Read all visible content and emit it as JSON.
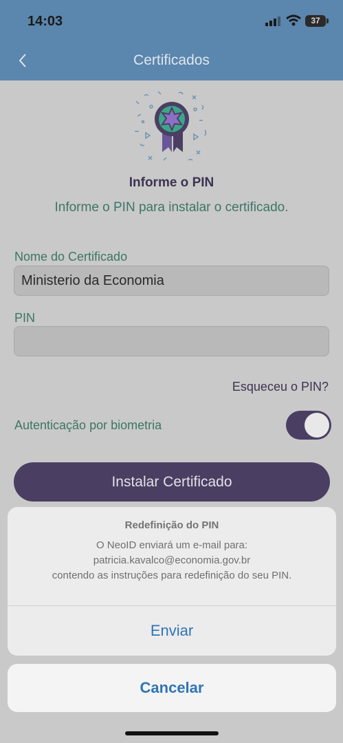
{
  "status": {
    "time": "14:03",
    "battery": "37"
  },
  "nav": {
    "title": "Certificados"
  },
  "icons": {
    "back": "chevron-left-icon",
    "illustration": "certificate-ribbon-icon"
  },
  "header": {
    "title": "Informe o PIN",
    "subtitle": "Informe o PIN para instalar o certificado."
  },
  "form": {
    "cert_label": "Nome do Certificado",
    "cert_value": "Ministerio da Economia",
    "pin_label": "PIN",
    "pin_value": "",
    "forgot_link": "Esqueceu o PIN?",
    "biometric_label": "Autenticação por biometria",
    "biometric_on": true,
    "install_button": "Instalar Certificado"
  },
  "action_sheet": {
    "title": "Redefinição do PIN",
    "line1": "O NeoID enviará um e-mail para:",
    "line2": "patricia.kavalco@economia.gov.br",
    "line3": "contendo as instruções para redefinição do seu PIN.",
    "send_button": "Enviar",
    "cancel_button": "Cancelar"
  },
  "colors": {
    "header_bg": "#5b86ad",
    "primary": "#4a3f62",
    "teal_text": "#3e7565",
    "link_blue": "#2f74b5"
  }
}
